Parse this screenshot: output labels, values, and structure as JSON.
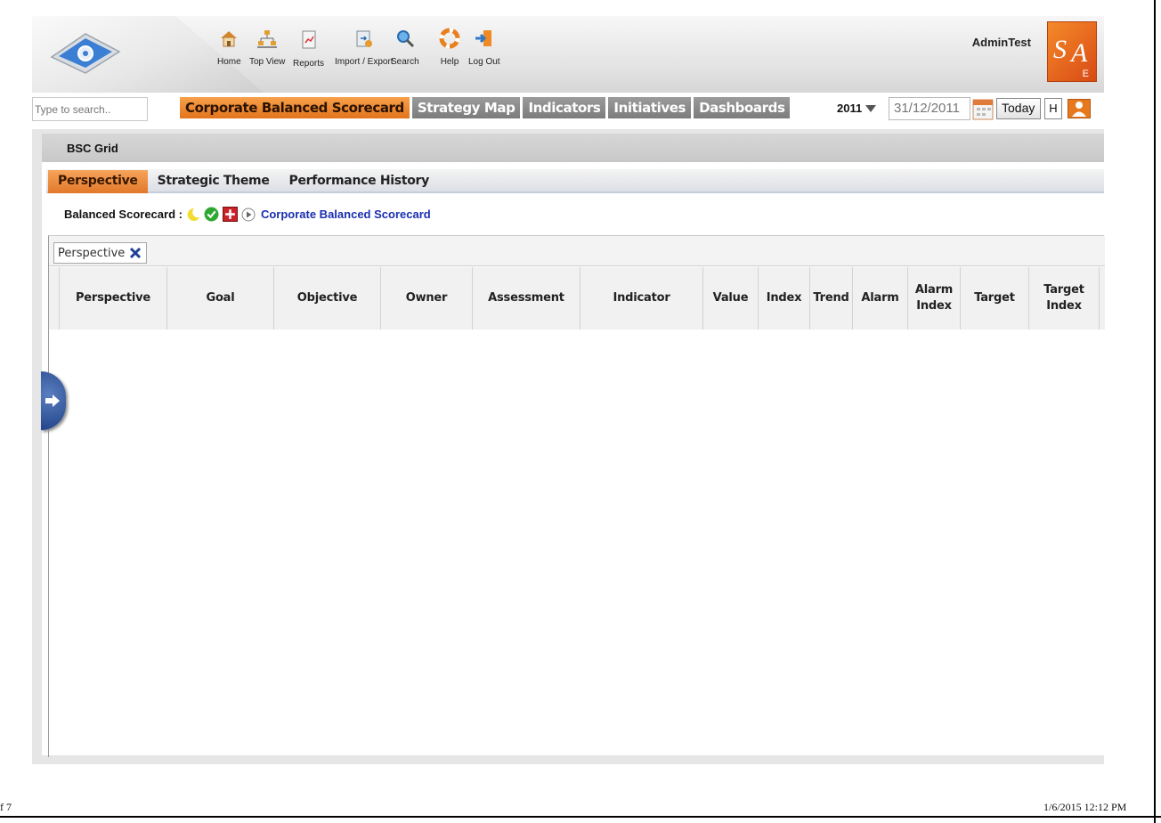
{
  "header": {
    "nav": [
      {
        "label": "Home",
        "icon": "home-icon"
      },
      {
        "label": "Top View",
        "icon": "hierarchy-icon"
      },
      {
        "label": "Reports",
        "icon": "report-icon"
      },
      {
        "label": "Import / Export",
        "icon": "import-export-icon"
      },
      {
        "label": "Search",
        "icon": "search-icon"
      },
      {
        "label": "Help",
        "icon": "help-lifebuoy-icon"
      },
      {
        "label": "Log Out",
        "icon": "logout-icon"
      }
    ],
    "user_name": "AdminTest",
    "brand_logo": {
      "letters": [
        "S",
        "A",
        "E"
      ]
    }
  },
  "toolbar": {
    "search_placeholder": "Type to search..",
    "tabs": [
      {
        "label": "Corporate Balanced Scorecard",
        "active": true
      },
      {
        "label": "Strategy Map",
        "active": false
      },
      {
        "label": "Indicators",
        "active": false
      },
      {
        "label": "Initiatives",
        "active": false
      },
      {
        "label": "Dashboards",
        "active": false
      }
    ],
    "year": "2011",
    "date": "31/12/2011",
    "today_label": "Today",
    "h_label": "H"
  },
  "panel": {
    "title": "BSC Grid",
    "subtabs": [
      {
        "label": "Perspective",
        "active": true
      },
      {
        "label": "Strategic Theme",
        "active": false
      },
      {
        "label": "Performance History",
        "active": false
      }
    ],
    "scorecard_label": "Balanced Scorecard :",
    "scorecard_link": "Corporate Balanced Scorecard",
    "group_chip": "Perspective",
    "columns": [
      "Perspective",
      "Goal",
      "Objective",
      "Owner",
      "Assessment",
      "Indicator",
      "Value",
      "Index",
      "Trend",
      "Alarm",
      "Alarm Index",
      "Target",
      "Target Index"
    ]
  },
  "footer": {
    "page": "f 7",
    "timestamp": "1/6/2015 12:12 PM"
  },
  "colors": {
    "active_tab": "#e2741c",
    "inactive_tab": "#7c7c7c",
    "link": "#1a2fb0"
  }
}
